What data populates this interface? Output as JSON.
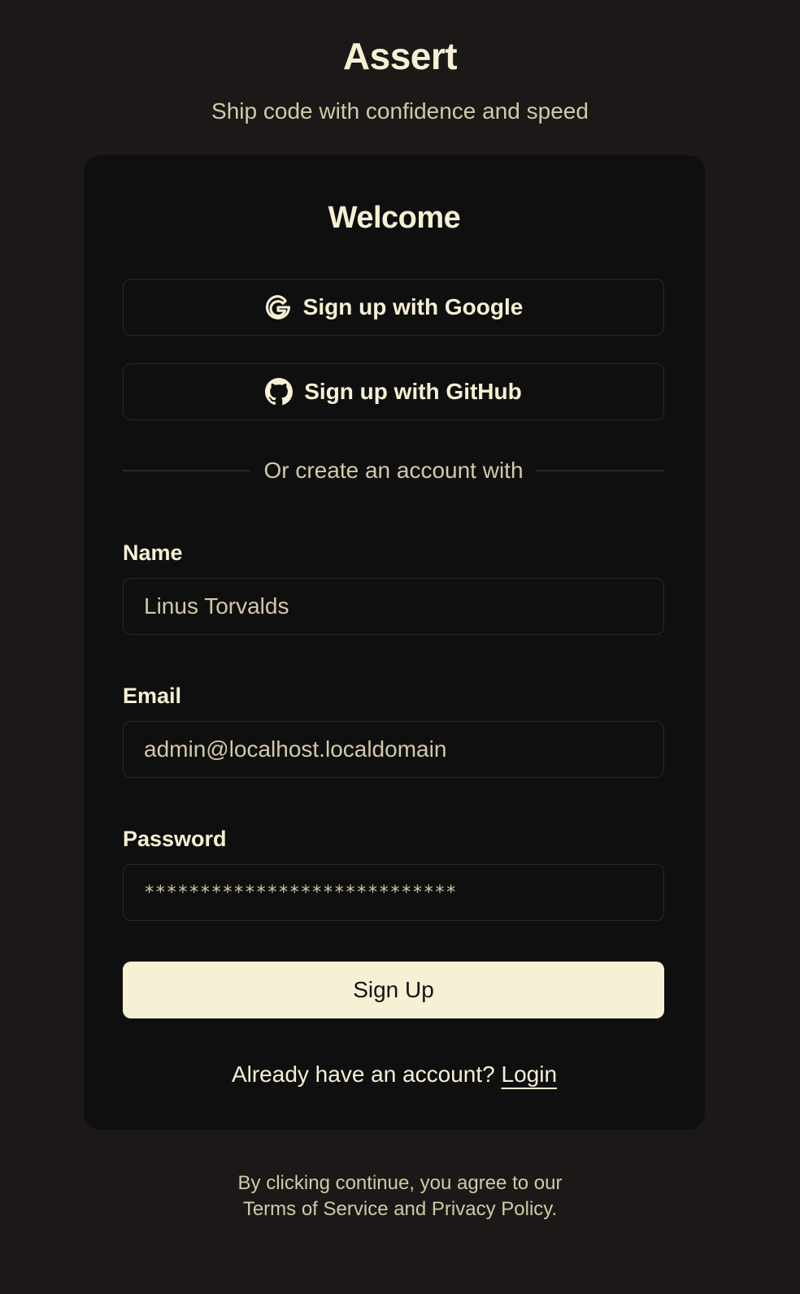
{
  "header": {
    "brand": "Assert",
    "tagline": "Ship code with confidence and speed"
  },
  "card": {
    "title": "Welcome",
    "google_button": "Sign up with Google",
    "github_button": "Sign up with GitHub",
    "divider_text": "Or create an account with",
    "fields": {
      "name": {
        "label": "Name",
        "value": "Linus Torvalds"
      },
      "email": {
        "label": "Email",
        "value": "admin@localhost.localdomain"
      },
      "password": {
        "label": "Password",
        "value": "****************************"
      }
    },
    "submit_label": "Sign Up",
    "login_prompt": "Already have an account?",
    "login_link": "Login"
  },
  "footer": {
    "line1": "By clicking continue, you agree to our",
    "line2": "Terms of Service and Privacy Policy."
  },
  "colors": {
    "page_bg": "#1b1817",
    "card_bg": "#100f0f",
    "accent": "#f6f0d4",
    "muted_text": "#d2c9a8"
  },
  "icons": {
    "google": "google-icon",
    "github": "github-icon"
  }
}
